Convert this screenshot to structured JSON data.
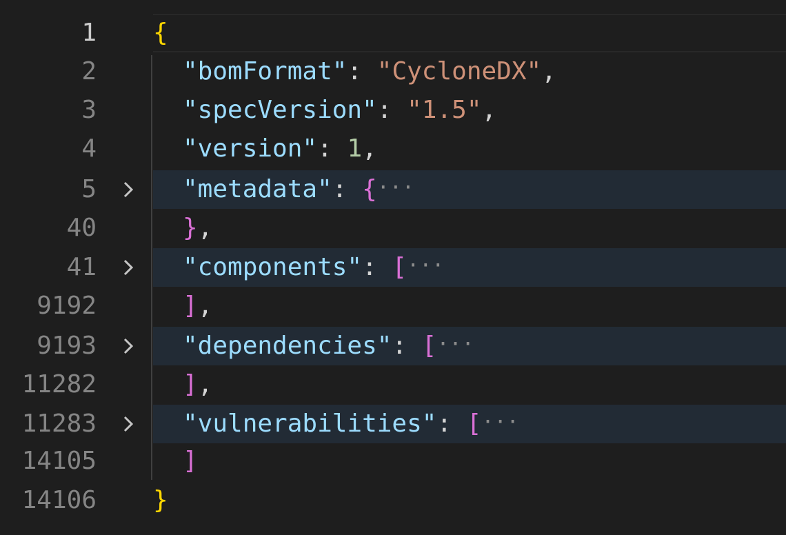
{
  "editor": {
    "language": "json",
    "colors": {
      "background": "#1e1e1e",
      "property_key": "#9cdcfe",
      "string_value": "#ce9178",
      "number_value": "#b5cea8",
      "bracket_level1": "#ffd700",
      "bracket_level2": "#da70d6",
      "fold_highlight": "#222b35",
      "line_number": "#858585"
    },
    "lines": [
      {
        "number": "1",
        "active": true,
        "fold": false
      },
      {
        "number": "2",
        "key": "\"bomFormat\"",
        "colon": ": ",
        "value": "\"CycloneDX\"",
        "trail": ","
      },
      {
        "number": "3",
        "key": "\"specVersion\"",
        "colon": ": ",
        "value": "\"1.5\"",
        "trail": ","
      },
      {
        "number": "4",
        "key": "\"version\"",
        "colon": ": ",
        "value": "1",
        "trail": ","
      },
      {
        "number": "5",
        "key": "\"metadata\"",
        "colon": ": ",
        "open": "{",
        "ellipsis": "···",
        "folded": true,
        "fold_icon": "chevron-right-icon"
      },
      {
        "number": "40",
        "close": "}",
        "trail": ","
      },
      {
        "number": "41",
        "key": "\"components\"",
        "colon": ": ",
        "open": "[",
        "ellipsis": "···",
        "folded": true,
        "fold_icon": "chevron-right-icon"
      },
      {
        "number": "9192",
        "close": "]",
        "trail": ","
      },
      {
        "number": "9193",
        "key": "\"dependencies\"",
        "colon": ": ",
        "open": "[",
        "ellipsis": "···",
        "folded": true,
        "fold_icon": "chevron-right-icon"
      },
      {
        "number": "11282",
        "close": "]",
        "trail": ","
      },
      {
        "number": "11283",
        "key": "\"vulnerabilities\"",
        "colon": ": ",
        "open": "[",
        "ellipsis": "···",
        "folded": true,
        "fold_icon": "chevron-right-icon"
      },
      {
        "number": "14105",
        "close": "]"
      },
      {
        "number": "14106"
      }
    ],
    "root_open": "{",
    "root_close": "}"
  }
}
